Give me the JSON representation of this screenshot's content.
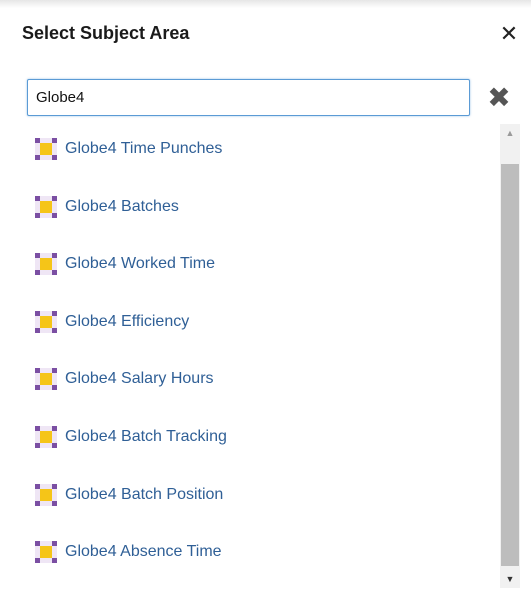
{
  "dialog": {
    "title": "Select Subject Area",
    "close_glyph": "✕"
  },
  "search": {
    "value": "Globe4",
    "clear_glyph": "✖"
  },
  "colors": {
    "accent": "#5b9bd5",
    "link": "#2f5f96",
    "icon_fill": "#f5c518",
    "icon_corner": "#7b4fa3"
  },
  "icon_name": "subject-area-icon",
  "scroll": {
    "up_glyph": "▲",
    "down_glyph": "▼"
  },
  "items": [
    {
      "label": "Globe4 Time Punches"
    },
    {
      "label": "Globe4 Batches"
    },
    {
      "label": "Globe4 Worked Time"
    },
    {
      "label": "Globe4 Efficiency"
    },
    {
      "label": "Globe4 Salary Hours"
    },
    {
      "label": "Globe4 Batch Tracking"
    },
    {
      "label": "Globe4 Batch Position"
    },
    {
      "label": "Globe4 Absence Time"
    }
  ]
}
